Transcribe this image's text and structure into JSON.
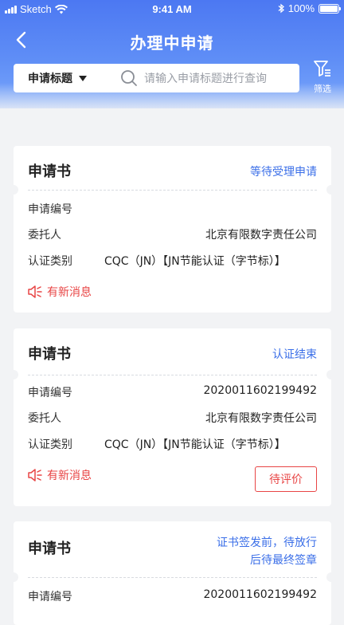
{
  "status_bar": {
    "carrier": "Sketch",
    "time": "9:41 AM",
    "battery": "100%"
  },
  "nav": {
    "title": "办理中申请"
  },
  "search": {
    "type_label": "申请标题",
    "placeholder": "请输入申请标题进行查询",
    "filter_label": "筛选"
  },
  "colors": {
    "accent": "#3b6fe8",
    "alert": "#e84545",
    "header": "#5f8ef6"
  },
  "cards": [
    {
      "title": "申请书",
      "status": "等待受理申请",
      "fields": [
        {
          "label": "申请编号",
          "value": ""
        },
        {
          "label": "委托人",
          "value": "北京有限数字责任公司"
        },
        {
          "label": "认证类别",
          "value": "CQC（JN）【JN节能认证（字节标）】"
        }
      ],
      "message": "有新消息"
    },
    {
      "title": "申请书",
      "status": "认证结束",
      "fields": [
        {
          "label": "申请编号",
          "value": "2020011602199492"
        },
        {
          "label": "委托人",
          "value": "北京有限数字责任公司"
        },
        {
          "label": "认证类别",
          "value": "CQC（JN）【JN节能认证（字节标）】"
        }
      ],
      "message": "有新消息",
      "action": "待评价"
    },
    {
      "title": "申请书",
      "status_line1": "证书签发前，待放行",
      "status_line2": "后待最终签章",
      "fields": [
        {
          "label": "申请编号",
          "value": "2020011602199492"
        }
      ]
    }
  ]
}
